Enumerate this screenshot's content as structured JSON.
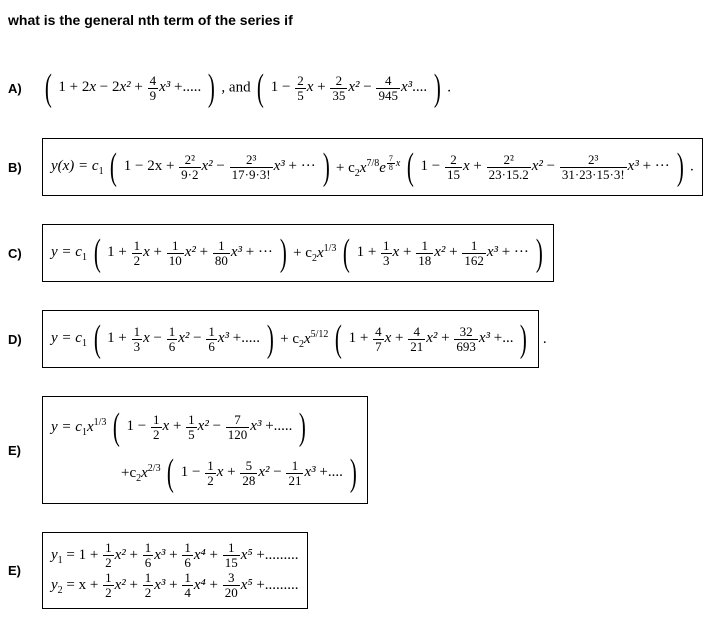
{
  "title": "what is the general nth term of the series if",
  "items": {
    "A": {
      "label": "A)",
      "series1_t0": "1 + 2",
      "series1_var": "x",
      "series1_t1": " − 2",
      "series1_f1_num": "4",
      "series1_f1_den": "9",
      "series1_tail": " +.....",
      "and": ", and ",
      "series2_t0": "1 − ",
      "series2_f1_num": "2",
      "series2_f1_den": "5",
      "series2_mid1": " + ",
      "series2_f2_num": "2",
      "series2_f2_den": "35",
      "series2_mid2": " − ",
      "series2_f3_num": "4",
      "series2_f3_den": "945",
      "series2_tail": "....",
      "dot": "."
    },
    "B": {
      "label": "B)",
      "lead": "y(x) = c",
      "sub1": "1",
      "p1_t0": "1 − 2x + ",
      "p1_f1_num": "2²",
      "p1_f1_den": "9·2",
      "p1_mid1": " − ",
      "p1_f2_num": "2³",
      "p1_f2_den": "17·9·3!",
      "p1_tail": " + ···",
      "plus_c2": " + c",
      "sub2": "2",
      "mid2": "x",
      "exp78": "7/8",
      "e": "e",
      "exp_outer_num": "7",
      "exp_outer_den": "8",
      "exp_outer_x": "x",
      "p2_t0": "1 − ",
      "p2_f1_num": "2",
      "p2_f1_den": "15",
      "p2_mid1": " + ",
      "p2_f2_num": "2²",
      "p2_f2_den": "23·15.2",
      "p2_mid2": " − ",
      "p2_f3_num": "2³",
      "p2_f3_den": "31·23·15·3!",
      "p2_tail": " + ···",
      "dot": "."
    },
    "C": {
      "label": "C)",
      "lead": "y = c",
      "sub1": "1",
      "p1_t0": "1 + ",
      "p1_f1_num": "1",
      "p1_f1_den": "2",
      "p1_mid1": " + ",
      "p1_f2_num": "1",
      "p1_f2_den": "10",
      "p1_mid2": " + ",
      "p1_f3_num": "1",
      "p1_f3_den": "80",
      "p1_tail": " + ···",
      "plus_c2": " + c",
      "sub2": "2",
      "mid_x": "x",
      "exp13": "1/3",
      "p2_t0": "1 + ",
      "p2_f1_num": "1",
      "p2_f1_den": "3",
      "p2_mid1": " + ",
      "p2_f2_num": "1",
      "p2_f2_den": "18",
      "p2_mid2": " + ",
      "p2_f3_num": "1",
      "p2_f3_den": "162",
      "p2_tail": " + ···"
    },
    "D": {
      "label": "D)",
      "lead": "y = c",
      "sub1": "1",
      "p1_t0": "1 + ",
      "p1_f1_num": "1",
      "p1_f1_den": "3",
      "p1_mid1": " − ",
      "p1_f2_num": "1",
      "p1_f2_den": "6",
      "p1_mid2": " − ",
      "p1_f3_num": "1",
      "p1_f3_den": "6",
      "p1_tail": " +.....",
      "plus_c2": " + c",
      "sub2": "2",
      "mid_x": "x",
      "exp512": "5/12",
      "p2_t0": "1 + ",
      "p2_f1_num": "4",
      "p2_f1_den": "7",
      "p2_mid1": " + ",
      "p2_f2_num": "4",
      "p2_f2_den": "21",
      "p2_mid2": " + ",
      "p2_f3_num": "32",
      "p2_f3_den": "693",
      "p2_tail": " +...",
      "dot": "."
    },
    "E1": {
      "label": "E)",
      "l1_lead": "y = c",
      "l1_sub1": "1",
      "l1_x": "x",
      "l1_exp": "1/3",
      "l1_t0": "1 − ",
      "l1_f1_num": "1",
      "l1_f1_den": "2",
      "l1_mid1": " + ",
      "l1_f2_num": "1",
      "l1_f2_den": "5",
      "l1_mid2": " − ",
      "l1_f3_num": "7",
      "l1_f3_den": "120",
      "l1_tail": " +.....",
      "l2_lead": "+c",
      "l2_sub2": "2",
      "l2_x": "x",
      "l2_exp": "2/3",
      "l2_t0": "1 − ",
      "l2_f1_num": "1",
      "l2_f1_den": "2",
      "l2_mid1": " + ",
      "l2_f2_num": "5",
      "l2_f2_den": "28",
      "l2_mid2": " − ",
      "l2_f3_num": "1",
      "l2_f3_den": "21",
      "l2_tail": " +...."
    },
    "E2": {
      "label": "E)",
      "l1_lead": "y",
      "l1_sub": "1",
      "l1_eq": " = 1 + ",
      "l1_f1_num": "1",
      "l1_f1_den": "2",
      "l1_mid1": " + ",
      "l1_f2_num": "1",
      "l1_f2_den": "6",
      "l1_mid2": " + ",
      "l1_f3_num": "1",
      "l1_f3_den": "6",
      "l1_mid3": " + ",
      "l1_f4_num": "1",
      "l1_f4_den": "15",
      "l1_tail": " +.........",
      "l2_lead": "y",
      "l2_sub": "2",
      "l2_eq": " = x + ",
      "l2_f1_num": "1",
      "l2_f1_den": "2",
      "l2_mid1": " + ",
      "l2_f2_num": "1",
      "l2_f2_den": "2",
      "l2_mid2": " + ",
      "l2_f3_num": "1",
      "l2_f3_den": "4",
      "l2_mid3": " + ",
      "l2_f4_num": "3",
      "l2_f4_den": "20",
      "l2_tail": " +........."
    }
  },
  "vars": {
    "x": "x",
    "x2": "x²",
    "x3": "x³",
    "x4": "x⁴",
    "x5": "x⁵"
  }
}
